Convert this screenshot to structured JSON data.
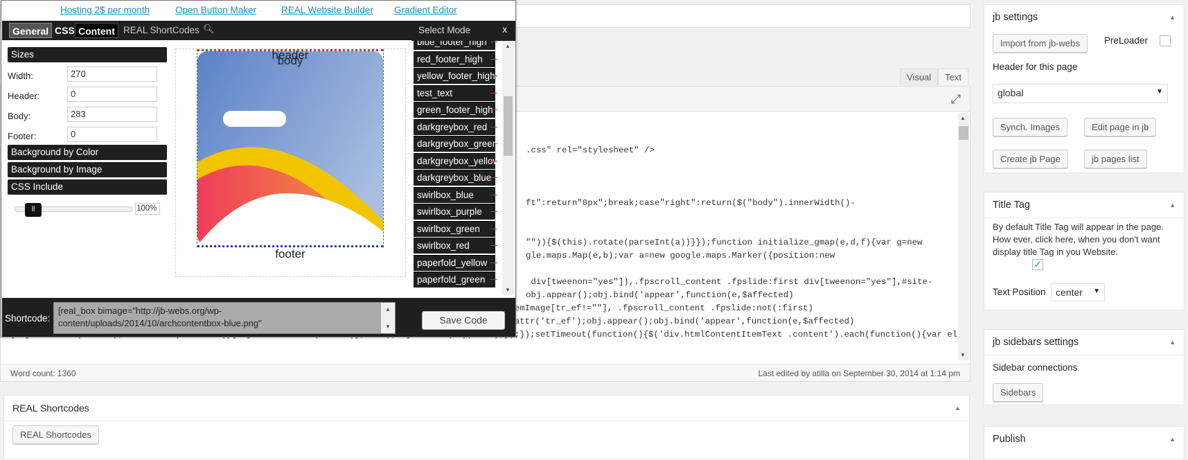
{
  "editor": {
    "tab_visual": "Visual",
    "tab_text": "Text",
    "code_lines": [
      "",
      "",
      ".css\" rel=\"stylesheet\" />",
      "",
      "",
      "",
      "ft\":return\"0px\";break;case\"right\":return($(\"body\").innerWidth()-",
      "",
      "",
      "\"\")){$(this).rotate(parseInt(a))}});function initialize_gmap(e,d,f){var g=new",
      "gle.maps.Map(e,b);var a=new google.maps.Marker({position:new",
      "",
      " div[tweenon=\"yes\"]),.fpscroll_content .fpslide:first div[tweenon=\"yes\"],#site-",
      "obj.appear();obj.bind('appear',function(e,$affected)",
      "(this).trigger('appear');});});$('.htmlContentItemImage[tr_ef!=\"\"]').not('.slider2d .htmlContentItemImage[tr_ef!=\"\"], .fpscroll_content .fpslide:not(:first)",
      ".htmlContentItemImage[tr_ef!=\"\"]').each(function(index,el){var obj = $(this);var effect = $(this).attr('tr_ef');obj.appear();obj.bind('appear',function(e,$affected)",
      "{obj.addClass(effect);setTimeout(function(){obj.removeClass(effect)},2700);obj.unbind('appear');});});setTimeout(function(){$('div.htmlContentItemText .content').each(function(){var elem ="
    ],
    "word_count": "Word count: 1360",
    "last_edited": "Last edited by atilla on September 30, 2014 at 1:14 pm"
  },
  "real_shortcodes_box": {
    "title": "REAL Shortcodes",
    "button": "REAL Shortcodes"
  },
  "sidebar": {
    "jb_settings": {
      "title": "jb settings",
      "import_button": "Import from jb-webs",
      "preloader_label": "PreLoader",
      "header_label": "Header for this page",
      "header_select": "global",
      "synch_button": "Synch. Images",
      "edit_button": "Edit page in jb",
      "create_button": "Create jb Page",
      "list_button": "jb pages list"
    },
    "title_tag": {
      "title": "Title Tag",
      "text": "By default Title Tag will appear in the page. How ever, click here, when you don't want display title Tag in you Website.",
      "checked": true,
      "position_label": "Text Position",
      "position_value": "center"
    },
    "jb_sidebars": {
      "title": "jb sidebars settings",
      "connections_label": "Sidebar connections",
      "button": "Sidebars"
    },
    "publish": {
      "title": "Publish"
    }
  },
  "popup": {
    "links": [
      "Hosting 2$ per month",
      "Open Button Maker",
      "REAL Website Builder",
      "Gradient Editor"
    ],
    "menu": {
      "general": "General",
      "css": "CSS",
      "content": "Content",
      "shortcodes": "REAL ShortCodes"
    },
    "sizes_header": "Sizes",
    "fields": [
      {
        "label": "Width:",
        "value": "270"
      },
      {
        "label": "Header:",
        "value": "0"
      },
      {
        "label": "Body:",
        "value": "283"
      },
      {
        "label": "Footer:",
        "value": "0"
      }
    ],
    "sections": [
      "Background by Color",
      "Background by Image",
      "CSS Include"
    ],
    "zoom_value": "100%",
    "zoom_fraction": 0.15,
    "preview": {
      "header": "header",
      "body": "body",
      "footer": "footer"
    },
    "mode_title": "Select Mode",
    "close": "x",
    "modes": [
      "blue_footer_high",
      "red_footer_high",
      "yellow_footer_high",
      "test_text",
      "green_footer_high",
      "darkgreybox_red",
      "darkgreybox_green",
      "darkgreybox_yellow",
      "darkgreybox_blue",
      "swirlbox_blue",
      "swirlbox_purple",
      "swirlbox_green",
      "swirlbox_red",
      "paperfold_yellow",
      "paperfold_green"
    ],
    "shortcode_label": "Shortcode:",
    "shortcode_value": "[real_box bimage=\"http://jb-webs.org/wp-content/uploads/2014/10/archcontentbox-blue.png\"",
    "save_button": "Save Code"
  },
  "colors": {
    "link": "#1e8cbe",
    "dark_bar": "#1f1f1f",
    "card_top": "#5b82c8",
    "arch_yellow": "#f3c400",
    "arch_red": "#ef3d5b",
    "arch_orange": "#f08a3a"
  },
  "icons": [
    "search-icon",
    "fullscreen-icon",
    "close-icon",
    "chevron-up-icon",
    "chevron-down-icon",
    "slider-handle-icon"
  ]
}
